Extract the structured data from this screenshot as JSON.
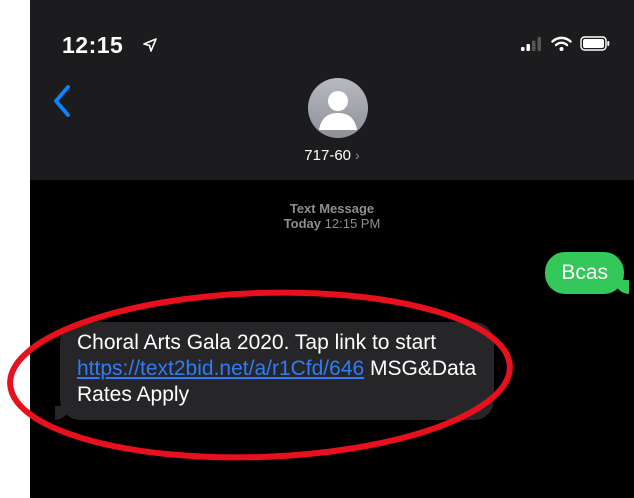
{
  "status_bar": {
    "time": "12:15"
  },
  "conversation": {
    "contact_name": "717-60",
    "chevron": "›",
    "meta_label": "Text Message",
    "meta_day": "Today",
    "meta_time": "12:15 PM"
  },
  "messages": {
    "outgoing_text": "Bcas",
    "incoming_prefix": "Choral Arts Gala 2020. Tap link to start ",
    "incoming_link": "https://text2bid.net/a/r1Cfd/646",
    "incoming_suffix": " MSG&Data Rates Apply"
  },
  "colors": {
    "outgoing_bubble": "#34c759",
    "incoming_bubble": "#262629",
    "link": "#2f7cf6",
    "accent": "#0a84ff",
    "annotation_ellipse": "#e8101c"
  },
  "icons": [
    "location-arrow-icon",
    "signal-icon",
    "wifi-icon",
    "battery-icon",
    "back-chevron-icon",
    "person-icon"
  ]
}
